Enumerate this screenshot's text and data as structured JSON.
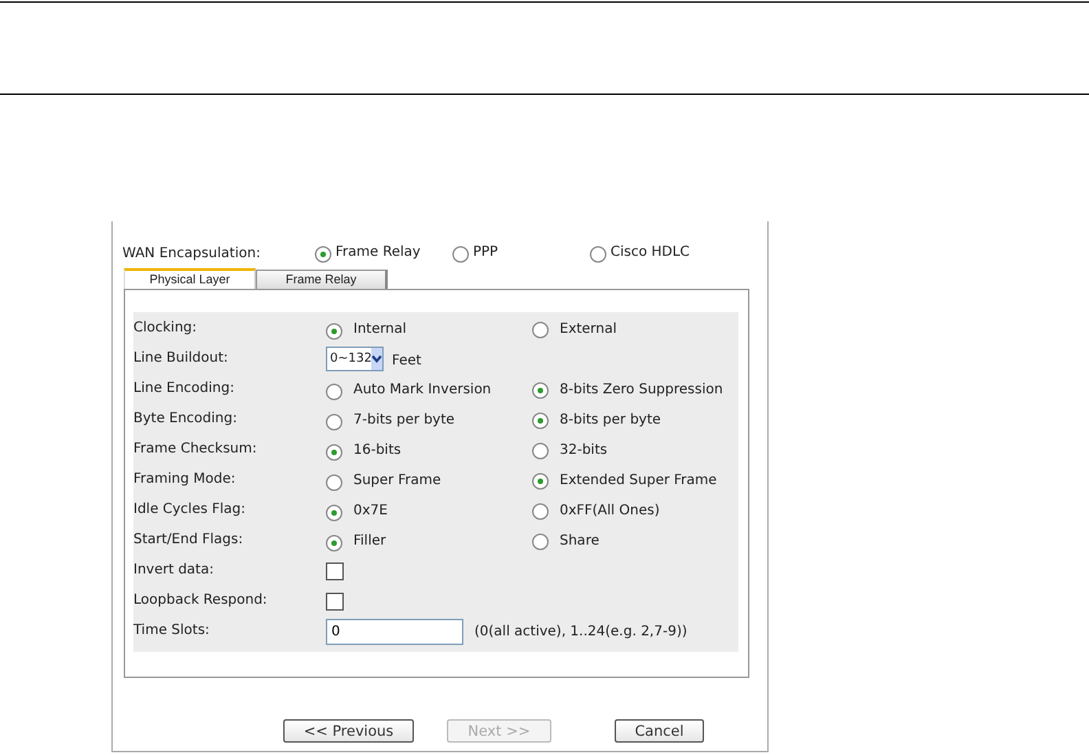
{
  "encapsulation": {
    "label": "WAN Encapsulation:",
    "options": [
      {
        "label": "Frame Relay",
        "selected": true
      },
      {
        "label": "PPP",
        "selected": false
      },
      {
        "label": "Cisco HDLC",
        "selected": false
      }
    ]
  },
  "tabs": [
    {
      "label": "Physical Layer",
      "selected": true
    },
    {
      "label": "Frame Relay",
      "selected": false
    }
  ],
  "rows": [
    {
      "kind": "radio",
      "label": "Clocking:",
      "options": [
        {
          "label": "Internal",
          "selected": true
        },
        {
          "label": "External",
          "selected": false
        }
      ]
    },
    {
      "kind": "select",
      "label": "Line Buildout:",
      "value": "0~132",
      "unit": "Feet"
    },
    {
      "kind": "radio",
      "label": "Line Encoding:",
      "options": [
        {
          "label": "Auto Mark Inversion",
          "selected": false
        },
        {
          "label": "8-bits Zero Suppression",
          "selected": true
        }
      ]
    },
    {
      "kind": "radio",
      "label": "Byte Encoding:",
      "options": [
        {
          "label": "7-bits per byte",
          "selected": false
        },
        {
          "label": "8-bits per byte",
          "selected": true
        }
      ]
    },
    {
      "kind": "radio",
      "label": "Frame Checksum:",
      "options": [
        {
          "label": "16-bits",
          "selected": true
        },
        {
          "label": "32-bits",
          "selected": false
        }
      ]
    },
    {
      "kind": "radio",
      "label": "Framing Mode:",
      "options": [
        {
          "label": "Super Frame",
          "selected": false
        },
        {
          "label": "Extended Super Frame",
          "selected": true
        }
      ]
    },
    {
      "kind": "radio",
      "label": "Idle Cycles Flag:",
      "options": [
        {
          "label": "0x7E",
          "selected": true
        },
        {
          "label": "0xFF(All Ones)",
          "selected": false
        }
      ]
    },
    {
      "kind": "radio",
      "label": "Start/End Flags:",
      "options": [
        {
          "label": "Filler",
          "selected": true
        },
        {
          "label": "Share",
          "selected": false
        }
      ]
    },
    {
      "kind": "checkbox",
      "label": "Invert data:",
      "checked": false
    },
    {
      "kind": "checkbox",
      "label": "Loopback Respond:",
      "checked": false
    },
    {
      "kind": "text",
      "label": "Time Slots:",
      "value": "0",
      "hint": "(0(all active), 1..24(e.g. 2,7-9))"
    }
  ],
  "buttons": [
    {
      "label": "<< Previous",
      "disabled": false
    },
    {
      "label": "Next >>",
      "disabled": true
    },
    {
      "label": "Cancel",
      "disabled": false
    }
  ]
}
